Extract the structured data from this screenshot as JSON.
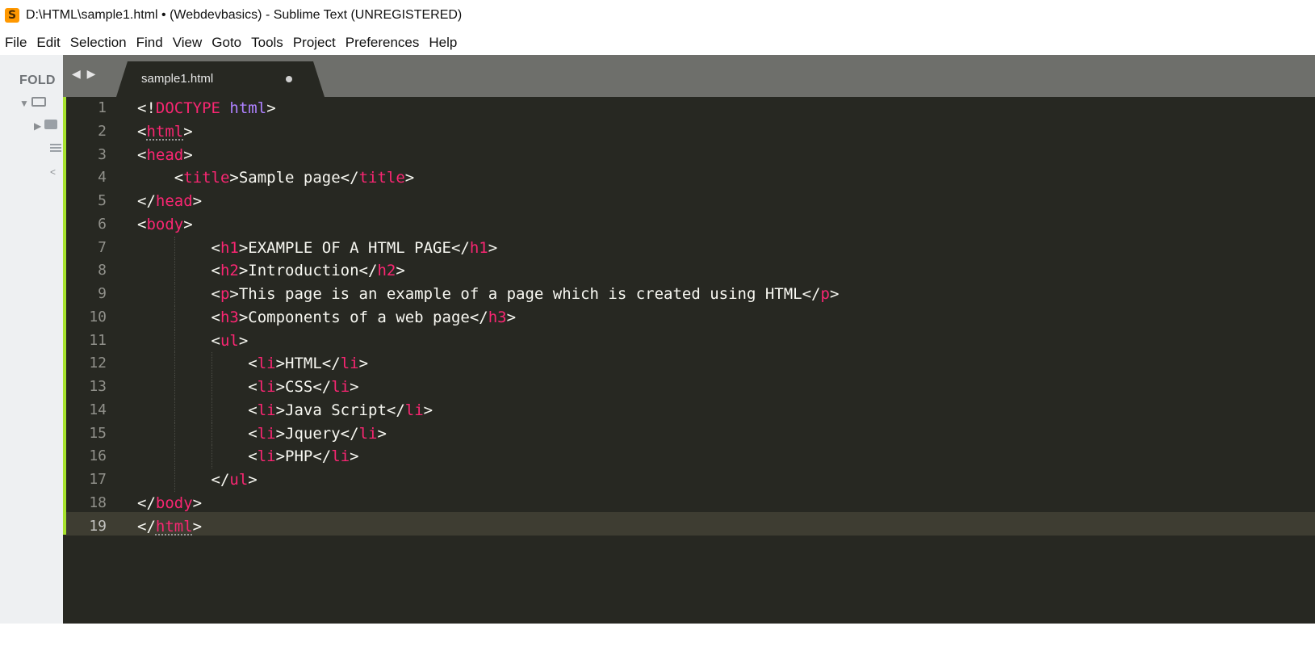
{
  "window": {
    "title": "D:\\HTML\\sample1.html • (Webdevbasics) - Sublime Text (UNREGISTERED)",
    "app_icon": "sublime-text-icon"
  },
  "menu": [
    "File",
    "Edit",
    "Selection",
    "Find",
    "View",
    "Goto",
    "Tools",
    "Project",
    "Preferences",
    "Help"
  ],
  "sidebar": {
    "label": "FOLD"
  },
  "tabs": {
    "nav_arrows": "◀ ▶",
    "active_tab": "sample1.html"
  },
  "editor": {
    "active_line": 19,
    "line_numbers": [
      "1",
      "2",
      "3",
      "4",
      "5",
      "6",
      "7",
      "8",
      "9",
      "10",
      "11",
      "12",
      "13",
      "14",
      "15",
      "16",
      "17",
      "18",
      "19"
    ],
    "lines": [
      [
        {
          "t": "<!"
        },
        {
          "t": "DOCTYPE",
          "c": "doctype"
        },
        {
          "t": " "
        },
        {
          "t": "html",
          "c": "attr-kw"
        },
        {
          "t": ">"
        }
      ],
      [
        {
          "t": "<"
        },
        {
          "t": "html",
          "c": "tag ul-tag"
        },
        {
          "t": ">"
        }
      ],
      [
        {
          "t": "<"
        },
        {
          "t": "head",
          "c": "tag"
        },
        {
          "t": ">"
        }
      ],
      [
        {
          "t": "    <"
        },
        {
          "t": "title",
          "c": "tag"
        },
        {
          "t": ">Sample page</"
        },
        {
          "t": "title",
          "c": "tag"
        },
        {
          "t": ">"
        }
      ],
      [
        {
          "t": "</"
        },
        {
          "t": "head",
          "c": "tag"
        },
        {
          "t": ">"
        }
      ],
      [
        {
          "t": "<"
        },
        {
          "t": "body",
          "c": "tag"
        },
        {
          "t": ">"
        }
      ],
      [
        {
          "t": "        <"
        },
        {
          "t": "h1",
          "c": "tag"
        },
        {
          "t": ">EXAMPLE OF A HTML PAGE</"
        },
        {
          "t": "h1",
          "c": "tag"
        },
        {
          "t": ">"
        }
      ],
      [
        {
          "t": "        <"
        },
        {
          "t": "h2",
          "c": "tag"
        },
        {
          "t": ">Introduction</"
        },
        {
          "t": "h2",
          "c": "tag"
        },
        {
          "t": ">"
        }
      ],
      [
        {
          "t": "        <"
        },
        {
          "t": "p",
          "c": "tag"
        },
        {
          "t": ">This page is an example of a page which is created using HTML</"
        },
        {
          "t": "p",
          "c": "tag"
        },
        {
          "t": ">"
        }
      ],
      [
        {
          "t": "        <"
        },
        {
          "t": "h3",
          "c": "tag"
        },
        {
          "t": ">Components of a web page</"
        },
        {
          "t": "h3",
          "c": "tag"
        },
        {
          "t": ">"
        }
      ],
      [
        {
          "t": "        <"
        },
        {
          "t": "ul",
          "c": "tag"
        },
        {
          "t": ">"
        }
      ],
      [
        {
          "t": "            <"
        },
        {
          "t": "li",
          "c": "tag"
        },
        {
          "t": ">HTML</"
        },
        {
          "t": "li",
          "c": "tag"
        },
        {
          "t": ">"
        }
      ],
      [
        {
          "t": "            <"
        },
        {
          "t": "li",
          "c": "tag"
        },
        {
          "t": ">CSS</"
        },
        {
          "t": "li",
          "c": "tag"
        },
        {
          "t": ">"
        }
      ],
      [
        {
          "t": "            <"
        },
        {
          "t": "li",
          "c": "tag"
        },
        {
          "t": ">Java Script</"
        },
        {
          "t": "li",
          "c": "tag"
        },
        {
          "t": ">"
        }
      ],
      [
        {
          "t": "            <"
        },
        {
          "t": "li",
          "c": "tag"
        },
        {
          "t": ">Jquery</"
        },
        {
          "t": "li",
          "c": "tag"
        },
        {
          "t": ">"
        }
      ],
      [
        {
          "t": "            <"
        },
        {
          "t": "li",
          "c": "tag"
        },
        {
          "t": ">PHP</"
        },
        {
          "t": "li",
          "c": "tag"
        },
        {
          "t": ">"
        }
      ],
      [
        {
          "t": "        </"
        },
        {
          "t": "ul",
          "c": "tag"
        },
        {
          "t": ">"
        }
      ],
      [
        {
          "t": "</"
        },
        {
          "t": "body",
          "c": "tag"
        },
        {
          "t": ">"
        }
      ],
      [
        {
          "t": "</"
        },
        {
          "t": "html",
          "c": "tag ul-tag"
        },
        {
          "t": ">"
        }
      ]
    ]
  },
  "colors": {
    "editor_bg": "#272822",
    "tag": "#f92672",
    "keyword": "#ae81ff",
    "text": "#f8f8f2",
    "modified_bar": "#a6e22e"
  }
}
